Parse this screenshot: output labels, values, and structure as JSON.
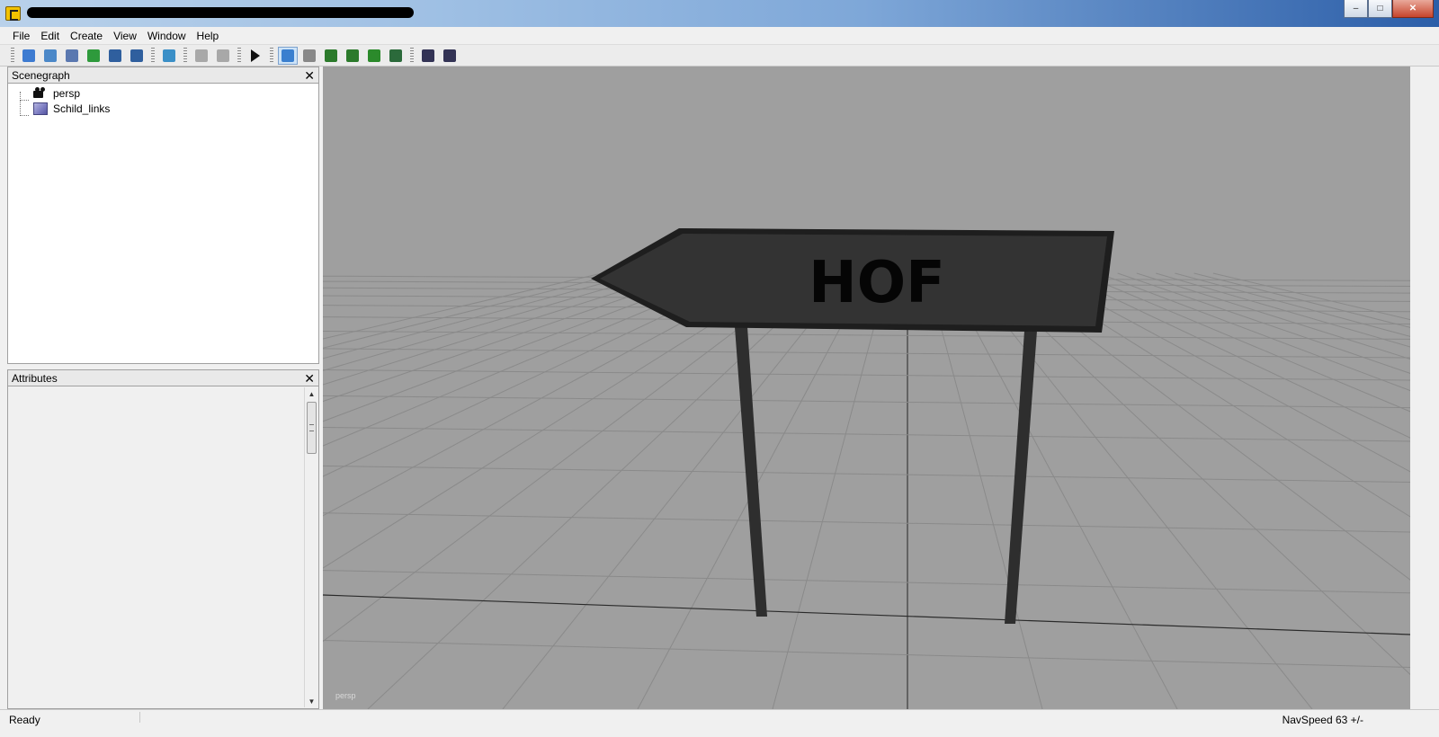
{
  "window": {
    "title": "",
    "controls": {
      "minimize": "–",
      "maximize": "□",
      "close": "✕"
    }
  },
  "menu": [
    "File",
    "Edit",
    "Create",
    "View",
    "Window",
    "Help"
  ],
  "toolbar": {
    "buttons": [
      {
        "icon": "new-scene-icon",
        "color": "#3d7bd1"
      },
      {
        "icon": "open-file-icon",
        "color": "#4b88c8"
      },
      {
        "icon": "script-icon",
        "color": "#5a78b0"
      },
      {
        "icon": "refresh-icon",
        "color": "#2e9a3c"
      },
      {
        "icon": "save-icon",
        "color": "#2f5f9e"
      },
      {
        "icon": "save-as-icon",
        "color": "#2f5f9e"
      },
      {
        "icon": "import-icon",
        "color": "#3a8fc7"
      },
      {
        "icon": "undo-icon",
        "color": "#a8a8a8"
      },
      {
        "icon": "redo-icon",
        "color": "#a8a8a8"
      },
      {
        "icon": "play-icon",
        "color": "#111111"
      },
      {
        "icon": "home-icon",
        "color": "#3a7fcf",
        "active": true
      },
      {
        "icon": "magnet-icon",
        "color": "#888888"
      },
      {
        "icon": "terrain-icon",
        "color": "#2b7a2b"
      },
      {
        "icon": "landscape-icon",
        "color": "#2b7a2b"
      },
      {
        "icon": "plant-icon",
        "color": "#2b8a2b"
      },
      {
        "icon": "export-icon",
        "color": "#2b6a3b"
      },
      {
        "icon": "render-icon",
        "color": "#333355"
      },
      {
        "icon": "settings-icon",
        "color": "#333355"
      }
    ]
  },
  "scenegraph": {
    "title": "Scenegraph",
    "close": "✕",
    "items": [
      {
        "label": "persp",
        "icon": "camera-icon"
      },
      {
        "label": "Schild_links",
        "icon": "cube-icon"
      }
    ]
  },
  "attributes": {
    "title": "Attributes",
    "close": "✕",
    "scroll_up": "▲",
    "scroll_down": "▼"
  },
  "viewport": {
    "camera_label": "persp",
    "sign_text": "HOF",
    "background_color": "#9f9f9f",
    "sign_color": "#333333"
  },
  "status": {
    "left": "Ready",
    "right": "NavSpeed 63 +/-"
  }
}
